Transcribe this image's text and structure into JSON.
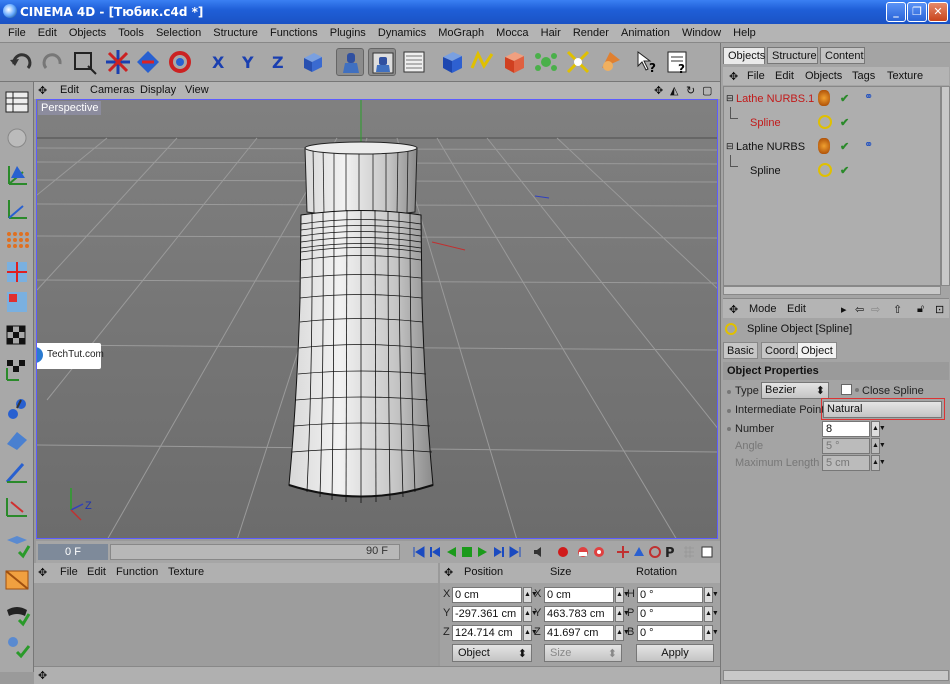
{
  "window": {
    "title": "CINEMA 4D - [Тюбик.c4d *]",
    "min": "_",
    "max": "❐",
    "close": "✕"
  },
  "menubar": [
    "File",
    "Edit",
    "Objects",
    "Tools",
    "Selection",
    "Structure",
    "Functions",
    "Plugins",
    "Dynamics",
    "MoGraph",
    "Mocca",
    "Hair",
    "Render",
    "Animation",
    "Window",
    "Help"
  ],
  "viewport": {
    "menu": [
      "Edit",
      "Cameras",
      "Display",
      "View"
    ],
    "label": "Perspective",
    "axis": {
      "z": "Z"
    },
    "watermark": "TechTut.com"
  },
  "timeline": {
    "current_frame": "0 F",
    "end_frame": "90 F"
  },
  "materials": {
    "menu": [
      "File",
      "Edit",
      "Function",
      "Texture"
    ]
  },
  "coordinates": {
    "headers": {
      "position": "Position",
      "size": "Size",
      "rotation": "Rotation"
    },
    "rows": [
      {
        "pos_axis": "X",
        "pos": "0 cm",
        "size_axis": "X",
        "size": "0 cm",
        "rot_axis": "H",
        "rot": "0 °"
      },
      {
        "pos_axis": "Y",
        "pos": "-297.361 cm",
        "size_axis": "Y",
        "size": "463.783 cm",
        "rot_axis": "P",
        "rot": "0 °"
      },
      {
        "pos_axis": "Z",
        "pos": "124.714 cm",
        "size_axis": "Z",
        "size": "41.697 cm",
        "rot_axis": "B",
        "rot": "0 °"
      }
    ],
    "mode": "Object",
    "size_mode": "Size",
    "apply": "Apply"
  },
  "object_manager": {
    "tabs": [
      "Objects",
      "Structure",
      "Content"
    ],
    "menu": [
      "File",
      "Edit",
      "Objects",
      "Tags",
      "Texture"
    ],
    "objects": [
      {
        "name": "Lathe NURBS.1",
        "selected": true
      },
      {
        "name": "Spline",
        "selected": true
      },
      {
        "name": "Lathe NURBS",
        "selected": false
      },
      {
        "name": "Spline",
        "selected": false
      }
    ]
  },
  "attribute_manager": {
    "menu": [
      "Mode",
      "Edit"
    ],
    "title": "Spline Object [Spline]",
    "tabs": [
      "Basic",
      "Coord.",
      "Object"
    ],
    "section": "Object Properties",
    "type_label": "Type",
    "type_value": "Bezier",
    "close_spline": "Close Spline",
    "intermediate_label": "Intermediate Points",
    "intermediate_value": "Natural",
    "number_label": "Number",
    "number_value": "8",
    "angle_label": "Angle",
    "angle_value": "5 °",
    "maxlen_label": "Maximum Length",
    "maxlen_value": "5 cm"
  },
  "colors": {
    "title_bar": "#1f5fd8",
    "selected_object": "#c21a1a",
    "highlight_box": "#dd3333"
  }
}
